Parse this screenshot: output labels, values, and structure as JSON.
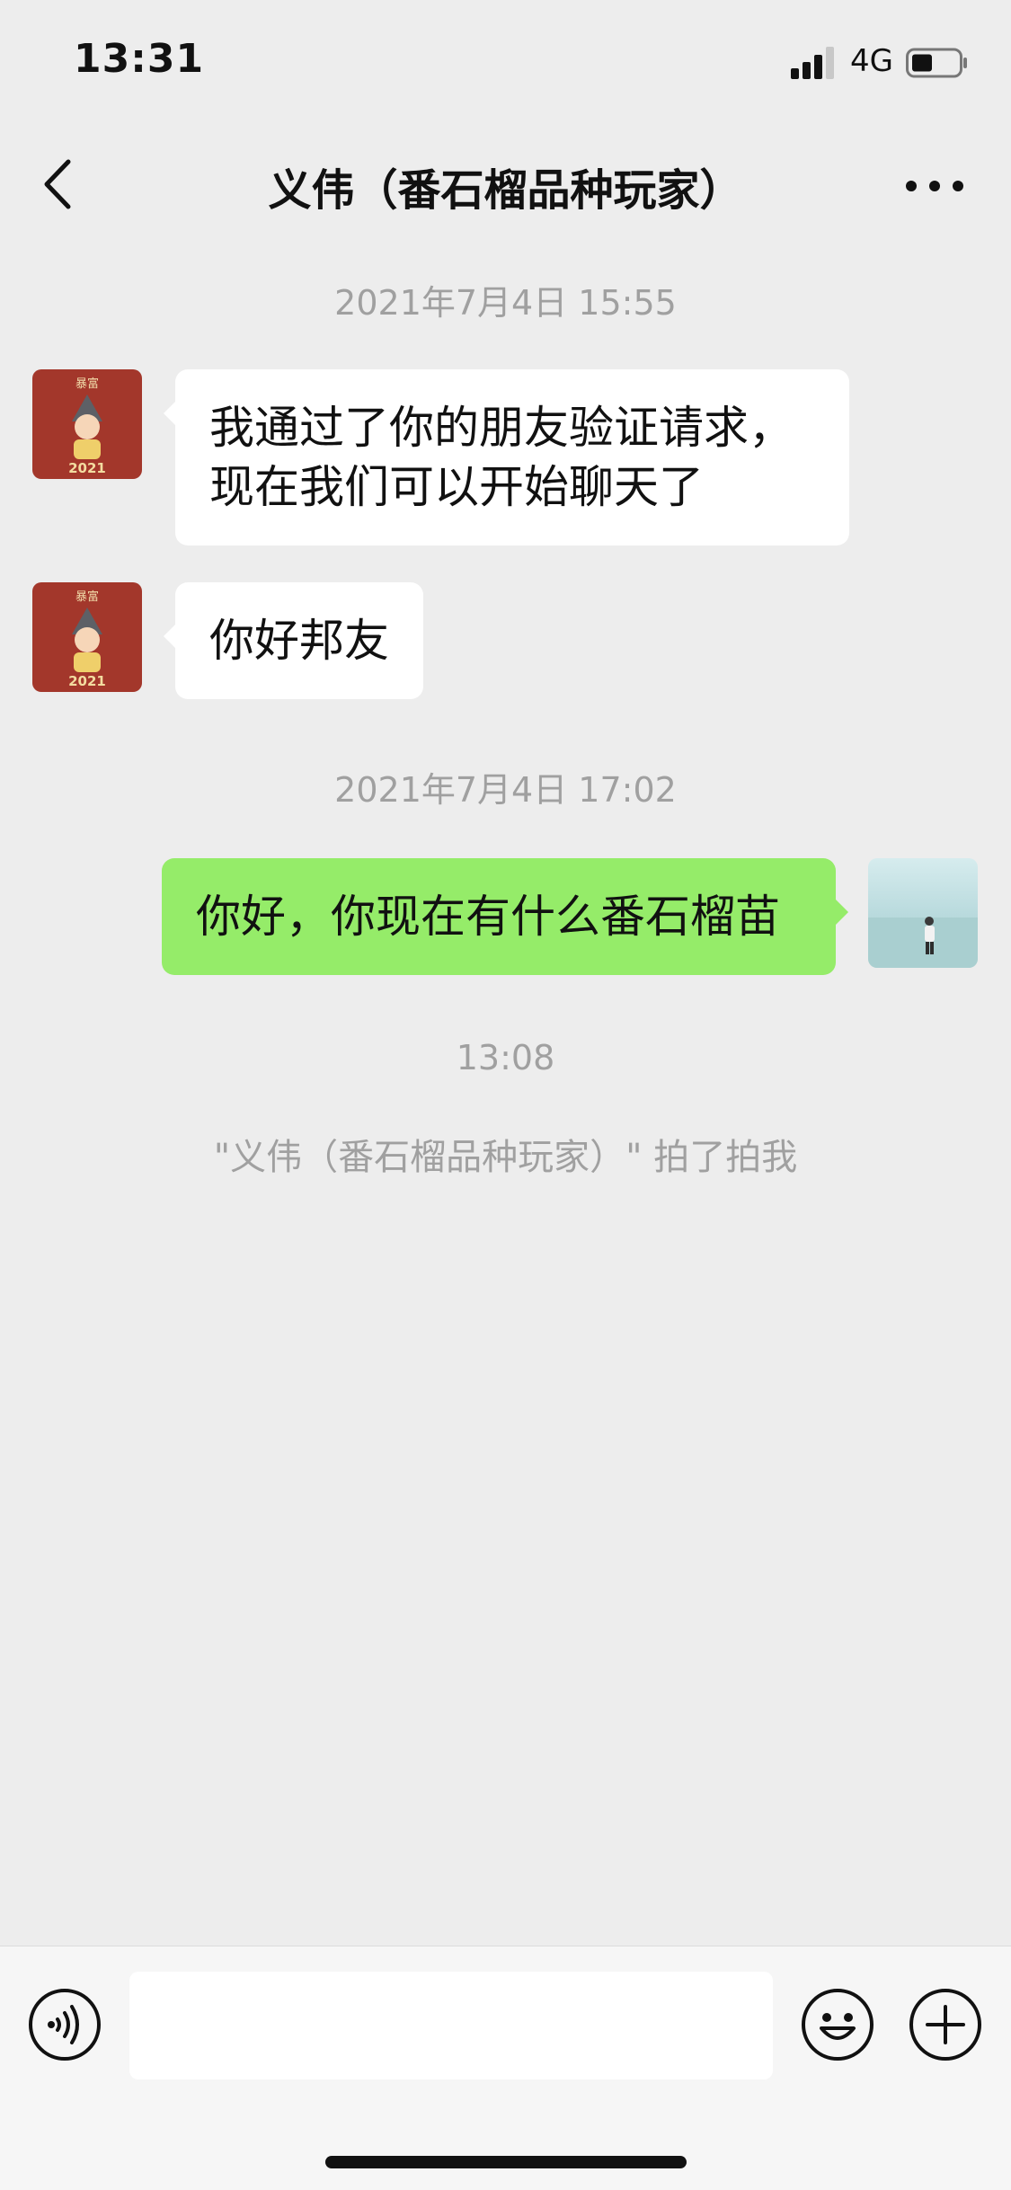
{
  "status_bar": {
    "time": "13:31",
    "network": "4G",
    "signal_icon": "signal-bars-icon",
    "battery_icon": "battery-icon"
  },
  "header": {
    "title": "义伟（番石榴品种玩家）",
    "back_icon": "chevron-left-icon",
    "more_icon": "more-dots-icon"
  },
  "messages": [
    {
      "type": "timestamp",
      "text": "2021年7月4日 15:55"
    },
    {
      "type": "incoming",
      "avatar": "contact-avatar",
      "text": "我通过了你的朋友验证请求，现在我们可以开始聊天了"
    },
    {
      "type": "incoming",
      "avatar": "contact-avatar",
      "text": "你好邦友"
    },
    {
      "type": "timestamp",
      "text": "2021年7月4日 17:02"
    },
    {
      "type": "outgoing",
      "avatar": "user-avatar",
      "text": "你好，你现在有什么番石榴苗"
    },
    {
      "type": "timestamp",
      "text": "13:08"
    },
    {
      "type": "system",
      "text": "\"义伟（番石榴品种玩家）\" 拍了拍我"
    }
  ],
  "avatar_labels": {
    "contact_badge_top": "暴富",
    "contact_badge_year": "2021"
  },
  "input_bar": {
    "voice_icon": "voice-icon",
    "emoji_icon": "emoji-icon",
    "plus_icon": "plus-icon",
    "value": "",
    "placeholder": ""
  },
  "colors": {
    "background": "#ededed",
    "outgoing_bubble": "#95ec69",
    "incoming_bubble": "#ffffff",
    "timestamp_text": "#a0a0a0"
  }
}
